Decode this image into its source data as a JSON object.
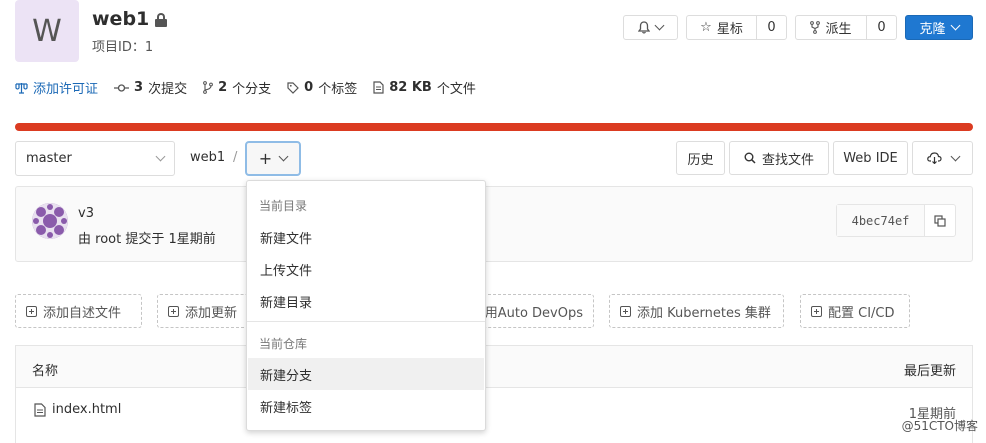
{
  "project": {
    "avatar_letter": "W",
    "name": "web1",
    "id_label": "项目ID：1"
  },
  "header_buttons": {
    "star_label": "星标",
    "star_count": "0",
    "fork_label": "派生",
    "fork_count": "0",
    "clone_label": "克隆"
  },
  "stats": {
    "license": "添加许可证",
    "commits_count": "3",
    "commits_label": "次提交",
    "branches_count": "2",
    "branches_label": "个分支",
    "tags_count": "0",
    "tags_label": "个标签",
    "size_value": "82 KB",
    "size_label": "个文件"
  },
  "tree": {
    "branch": "master",
    "breadcrumb": "web1",
    "separator": "/",
    "add_symbol": "+"
  },
  "tree_buttons": {
    "history": "历史",
    "find_file": "查找文件",
    "web_ide": "Web IDE"
  },
  "commit": {
    "title": "v3",
    "meta": "由 root 提交于 1星期前",
    "sha": "4bec74ef"
  },
  "quick_actions": [
    "添加自述文件",
    "添加更新",
    "用Auto DevOps",
    "添加 Kubernetes 集群",
    "配置 CI/CD"
  ],
  "file_table": {
    "col_name": "名称",
    "col_updated": "最后更新",
    "rows": [
      {
        "name": "index.html",
        "updated": "1星期前"
      }
    ]
  },
  "dropdown": {
    "section1_header": "当前目录",
    "new_file": "新建文件",
    "upload_file": "上传文件",
    "new_directory": "新建目录",
    "section2_header": "当前仓库",
    "new_branch": "新建分支",
    "new_tag": "新建标签"
  },
  "watermark": "@51CTO博客",
  "colors": {
    "accent_blue": "#1f78d1",
    "progress_orange": "#db3b21",
    "avatar_bg": "#ece3f5"
  }
}
